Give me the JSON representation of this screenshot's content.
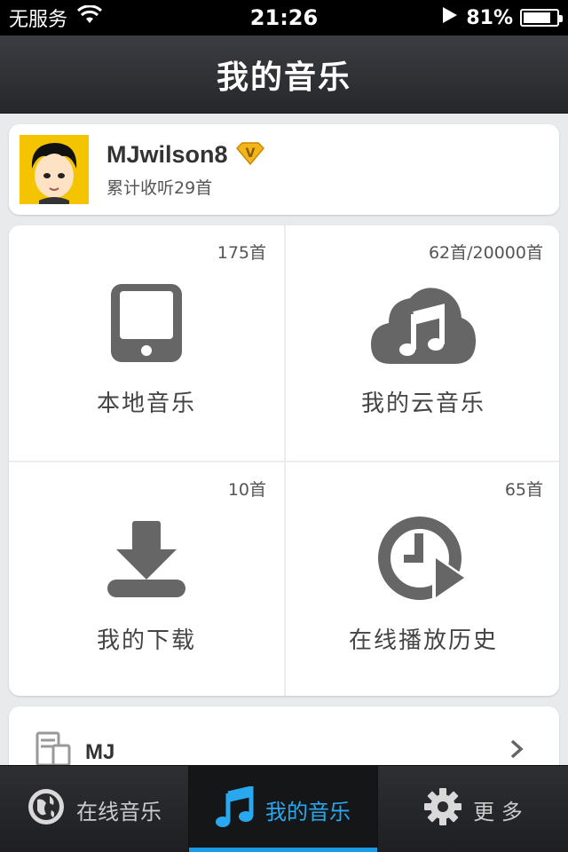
{
  "status_bar": {
    "carrier": "无服务",
    "time": "21:26",
    "battery": "81%",
    "battery_level": 0.81,
    "icons": [
      "wifi-icon",
      "location-arrow-icon",
      "battery-icon"
    ]
  },
  "nav": {
    "title": "我的音乐"
  },
  "profile": {
    "username": "MJwilson8",
    "vip_badge": "V",
    "listen_count": "累计收听29首"
  },
  "grid": {
    "local": {
      "label": "本地音乐",
      "count": "175首",
      "icon": "tablet-icon"
    },
    "cloud": {
      "label": "我的云音乐",
      "count": "62首/20000首",
      "icon": "cloud-music-icon"
    },
    "download": {
      "label": "我的下载",
      "count": "10首",
      "icon": "download-icon"
    },
    "history": {
      "label": "在线播放历史",
      "count": "65首",
      "icon": "history-play-icon"
    }
  },
  "playlist": {
    "name": "MJ",
    "icon": "playlist-icon"
  },
  "tabs": [
    {
      "label": "在线音乐",
      "icon": "globe-icon",
      "active": false
    },
    {
      "label": "我的音乐",
      "icon": "music-note-icon",
      "active": true
    },
    {
      "label": "更 多",
      "icon": "gear-icon",
      "active": false
    }
  ],
  "colors": {
    "accent": "#29a8f0",
    "icon_gray": "#666666",
    "vip_gold": "#f2b51a"
  }
}
